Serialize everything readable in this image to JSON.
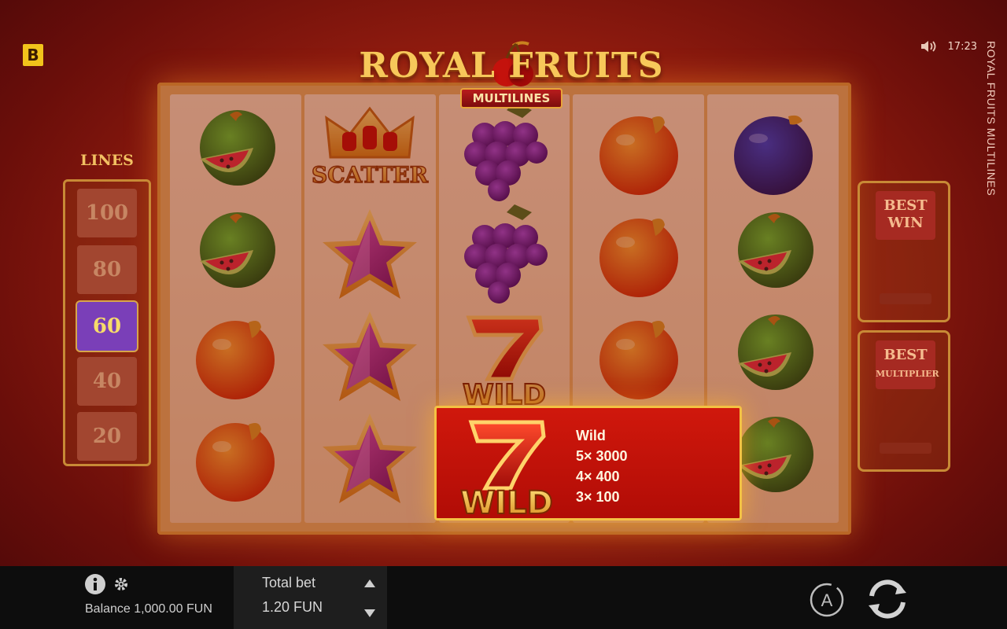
{
  "brand": {
    "logo_letter": "B"
  },
  "status": {
    "time": "17:23",
    "icon": "speaker-icon"
  },
  "game_title": {
    "main": "ROYAL FRUITS",
    "sub": "MULTILINES",
    "vertical": "ROYAL FRUITS MULTILINES"
  },
  "lines": {
    "label": "LINES",
    "options": [
      "100",
      "80",
      "60",
      "40",
      "20"
    ],
    "selected": "60"
  },
  "reels": [
    [
      "watermelon",
      "watermelon",
      "orange",
      "orange"
    ],
    [
      "scatter-crown",
      "star",
      "star",
      "star"
    ],
    [
      "grapes",
      "grapes",
      "wild-seven",
      "wild-seven"
    ],
    [
      "orange",
      "orange",
      "orange",
      "orange"
    ],
    [
      "plum",
      "watermelon",
      "watermelon",
      "watermelon"
    ]
  ],
  "symbol_labels": {
    "scatter": "SCATTER",
    "wild": "WILD",
    "seven": "7"
  },
  "best_win": {
    "label_line1": "BEST",
    "label_line2": "WIN"
  },
  "best_multiplier": {
    "label_line1": "BEST",
    "label_line2": "MULTIPLIER"
  },
  "paytable_popup": {
    "symbol": "wild-seven",
    "name": "Wild",
    "payouts": [
      "5× 3000",
      "4× 400",
      "3× 100"
    ]
  },
  "bottom_bar": {
    "balance_label": "Balance 1,000.00 FUN",
    "total_bet_label": "Total bet",
    "total_bet_value": "1.20 FUN",
    "autoplay_letter": "A"
  },
  "colors": {
    "accent_gold": "#f4c144",
    "frame": "#e6a640",
    "selected_line": "#7a3fb8",
    "popup_red": "#c0120a"
  }
}
